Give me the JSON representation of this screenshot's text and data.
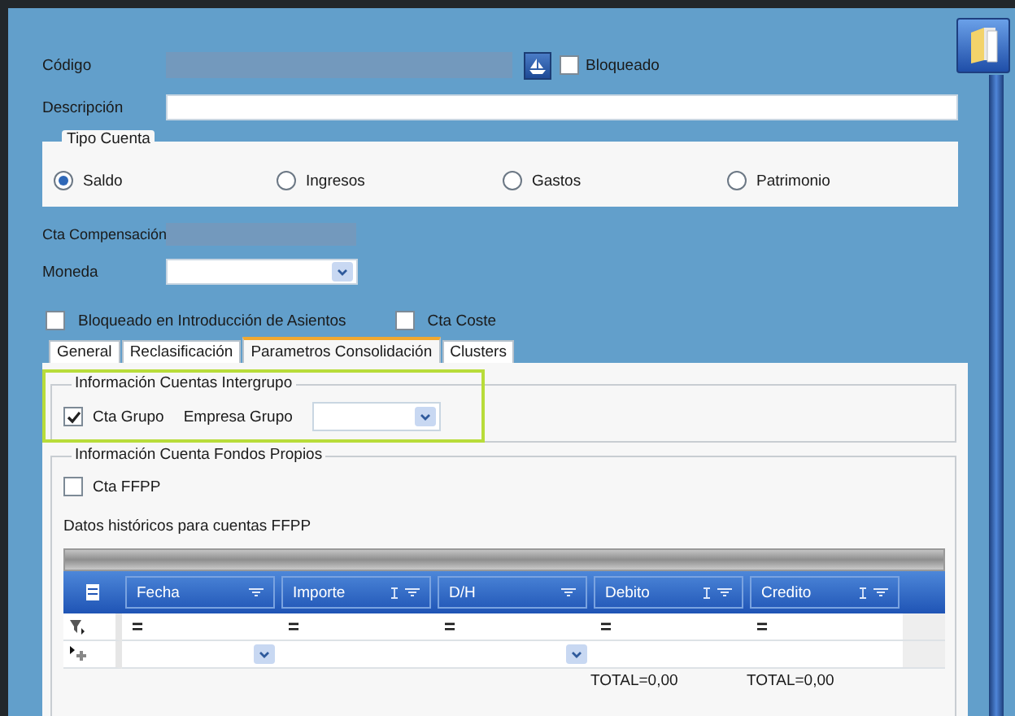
{
  "codigo": {
    "label": "Código",
    "locked": {
      "label": "Bloqueado",
      "checked": false
    }
  },
  "descripcion": {
    "label": "Descripción"
  },
  "tipo_cuenta": {
    "title": "Tipo Cuenta",
    "options": [
      {
        "label": "Saldo",
        "selected": true
      },
      {
        "label": "Ingresos",
        "selected": false
      },
      {
        "label": "Gastos",
        "selected": false
      },
      {
        "label": "Patrimonio",
        "selected": false
      }
    ]
  },
  "cta_compensacion": {
    "label": "Cta Compensación"
  },
  "moneda": {
    "label": "Moneda"
  },
  "flags": [
    {
      "label": "Bloqueado en Introducción de Asientos",
      "checked": false
    },
    {
      "label": "Cta Coste",
      "checked": false
    }
  ],
  "tabs": [
    {
      "label": "General",
      "selected": false
    },
    {
      "label": "Reclasificación",
      "selected": false
    },
    {
      "label": "Parametros Consolidación",
      "selected": true
    },
    {
      "label": "Clusters",
      "selected": false
    }
  ],
  "intergrupo": {
    "title": "Información Cuentas Intergrupo",
    "highlighted": true,
    "cta_grupo": {
      "label": "Cta Grupo",
      "checked": true
    },
    "empresa_grupo": {
      "label": "Empresa Grupo"
    }
  },
  "fondos_propios": {
    "title": "Información Cuenta Fondos Propios",
    "cta_ffpp": {
      "label": "Cta FFPP",
      "checked": false
    },
    "caption": "Datos históricos para cuentas FFPP",
    "table": {
      "columns": [
        {
          "label": "Fecha",
          "kind": "date",
          "summable": false,
          "filter": "="
        },
        {
          "label": "Importe",
          "kind": "number",
          "summable": true,
          "filter": "="
        },
        {
          "label": "D/H",
          "kind": "choice",
          "summable": false,
          "filter": "="
        },
        {
          "label": "Debito",
          "kind": "number",
          "summable": true,
          "filter": "=",
          "total": "TOTAL=0,00"
        },
        {
          "label": "Credito",
          "kind": "number",
          "summable": true,
          "filter": "=",
          "total": "TOTAL=0,00"
        }
      ]
    }
  }
}
